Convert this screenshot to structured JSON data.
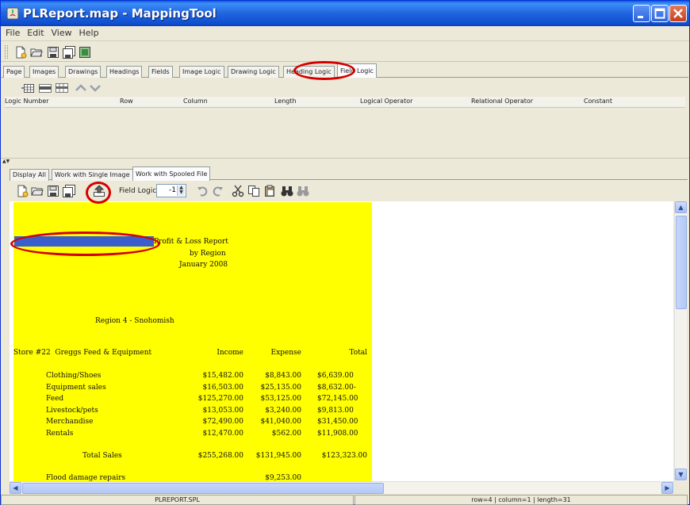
{
  "window": {
    "title": "PLReport.map - MappingTool"
  },
  "menu": [
    "File",
    "Edit",
    "View",
    "Help"
  ],
  "design_tabs": [
    "Page",
    "Images",
    "Drawings",
    "Headings",
    "Fields",
    "Image Logic",
    "Drawing Logic",
    "Heading Logic",
    "Field Logic"
  ],
  "design_active_tab": "Field Logic",
  "field_logic_columns": [
    "Logic Number",
    "Row",
    "Column",
    "Length",
    "Logical Operator",
    "Relational Operator",
    "Constant"
  ],
  "view_tabs": [
    "Display All",
    "Work with Single Image",
    "Work with Spooled File"
  ],
  "view_active_tab": "Work with Spooled File",
  "field_logic": {
    "label": "Field Logic:",
    "value": "-1"
  },
  "report": {
    "title_lines": [
      "Profit & Loss Report",
      "by Region",
      "January 2008"
    ],
    "region": "Region 4 - Snohomish",
    "store": "Store #22  Greggs Feed & Equipment",
    "headers": [
      "Income",
      "Expense",
      "Total"
    ],
    "rows": [
      {
        "label": "Clothing/Shoes",
        "income": "$15,482.00",
        "expense": "$8,843.00",
        "total": "$6,639.00"
      },
      {
        "label": "Equipment sales",
        "income": "$16,503.00",
        "expense": "$25,135.00",
        "total": "$8,632.00-"
      },
      {
        "label": "Feed",
        "income": "$125,270.00",
        "expense": "$53,125.00",
        "total": "$72,145.00"
      },
      {
        "label": "Livestock/pets",
        "income": "$13,053.00",
        "expense": "$3,240.00",
        "total": "$9,813.00"
      },
      {
        "label": "Merchandise",
        "income": "$72,490.00",
        "expense": "$41,040.00",
        "total": "$31,450.00"
      },
      {
        "label": "Rentals",
        "income": "$12,470.00",
        "expense": "$562.00",
        "total": "$11,908.00"
      }
    ],
    "total_sales": {
      "label": "Total Sales",
      "income": "$255,268.00",
      "expense": "$131,945.00",
      "total": "$123,323.00"
    },
    "extra": {
      "label": "Flood damage repairs",
      "expense": "$9,253.00"
    }
  },
  "status": {
    "file": "PLREPORT.SPL",
    "position": "row=4 | column=1 | length=31"
  },
  "colors": {
    "spool_background": "#ffff00",
    "selection": "#3a5fcd",
    "annotation": "#d40000",
    "titlebar": "#0a5bd8"
  }
}
